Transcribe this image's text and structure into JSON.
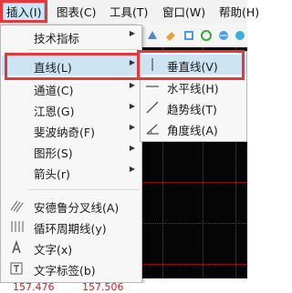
{
  "menubar": {
    "items": [
      {
        "label": "插入(I)"
      },
      {
        "label": "图表(C)"
      },
      {
        "label": "工具(T)"
      },
      {
        "label": "窗口(W)"
      },
      {
        "label": "帮助(H)"
      }
    ]
  },
  "insert_menu": {
    "items": [
      {
        "label": "技术指标",
        "icon": "none",
        "has_submenu": true
      },
      {
        "label": "直线(L)",
        "icon": "none",
        "has_submenu": true
      },
      {
        "label": "通道(C)",
        "icon": "none",
        "has_submenu": true
      },
      {
        "label": "江恩(G)",
        "icon": "none",
        "has_submenu": true
      },
      {
        "label": "斐波纳奇(F)",
        "icon": "none",
        "has_submenu": true
      },
      {
        "label": "图形(S)",
        "icon": "none",
        "has_submenu": true
      },
      {
        "label": "箭头(r)",
        "icon": "none",
        "has_submenu": true
      },
      {
        "label": "安德鲁分叉线(A)",
        "icon": "andrews-pitchfork-icon",
        "has_submenu": false
      },
      {
        "label": "循环周期线(y)",
        "icon": "cycle-lines-icon",
        "has_submenu": false
      },
      {
        "label": "文字(x)",
        "icon": "text-icon",
        "has_submenu": false
      },
      {
        "label": "文字标签(b)",
        "icon": "text-label-icon",
        "has_submenu": false
      }
    ]
  },
  "lines_submenu": {
    "items": [
      {
        "label": "垂直线(V)",
        "icon": "vertical-line-icon"
      },
      {
        "label": "水平线(H)",
        "icon": "horizontal-line-icon"
      },
      {
        "label": "趋势线(T)",
        "icon": "trendline-icon"
      },
      {
        "label": "角度线(A)",
        "icon": "angle-line-icon"
      }
    ]
  },
  "status": {
    "values": [
      "157.476",
      "157.506"
    ]
  },
  "colors": {
    "highlight_box": "#e0393e",
    "hover": "#cde4f5",
    "chart_background": "#050505"
  }
}
